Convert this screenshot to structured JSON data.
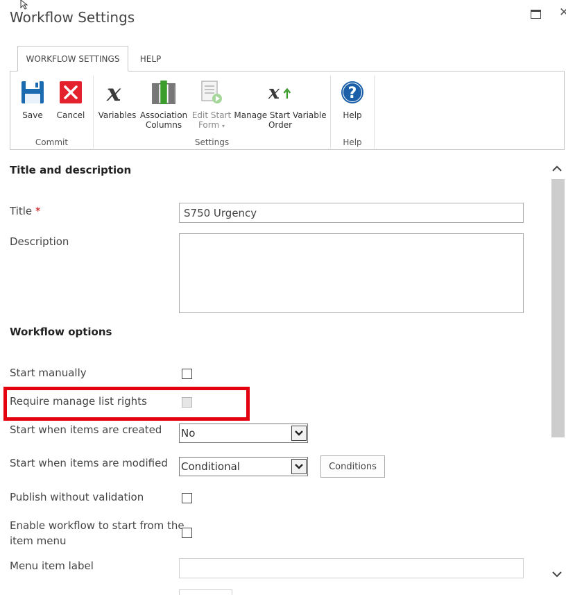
{
  "dialog": {
    "title": "Workflow Settings"
  },
  "tabs": [
    {
      "label": "WORKFLOW SETTINGS"
    },
    {
      "label": "HELP"
    }
  ],
  "ribbon": {
    "groups": [
      {
        "label": "Commit"
      },
      {
        "label": "Settings"
      },
      {
        "label": "Help"
      }
    ],
    "buttons": {
      "save": {
        "line1": "Save",
        "icon": "save-icon"
      },
      "cancel": {
        "line1": "Cancel",
        "icon": "cancel-icon"
      },
      "variables": {
        "line1": "Variables",
        "icon": "variable-icon"
      },
      "association_columns": {
        "line1": "Association",
        "line2": "Columns",
        "icon": "columns-icon"
      },
      "edit_start_form": {
        "line1": "Edit Start",
        "line2": "Form",
        "caret": "▾",
        "icon": "edit-form-icon",
        "disabled": true
      },
      "manage_start_variable_order": {
        "line1": "Manage Start Variable",
        "line2": "Order",
        "icon": "variable-order-icon"
      },
      "help": {
        "line1": "Help",
        "icon": "help-icon"
      }
    }
  },
  "sections": {
    "title_description": {
      "heading": "Title and description"
    },
    "workflow_options": {
      "heading": "Workflow options"
    }
  },
  "fields": {
    "title": {
      "label": "Title",
      "required_marker": "*",
      "value": "S750 Urgency"
    },
    "description": {
      "label": "Description",
      "value": ""
    },
    "start_manually": {
      "label": "Start manually",
      "checked": false
    },
    "require_manage_list_rights": {
      "label": "Require manage list rights",
      "checked": false,
      "disabled": true
    },
    "start_when_created": {
      "label": "Start when items are created",
      "selected": "No"
    },
    "start_when_modified": {
      "label": "Start when items are modified",
      "selected": "Conditional",
      "button": "Conditions"
    },
    "publish_without_validation": {
      "label": "Publish without validation",
      "checked": false
    },
    "enable_item_menu": {
      "label_line1": "Enable workflow to start from the",
      "label_line2": "item menu",
      "checked": false
    },
    "menu_item_label": {
      "label": "Menu item label",
      "value": ""
    }
  },
  "colors": {
    "save_blue": "#1c6ab0",
    "cancel_red": "#e3222d",
    "help_blue": "#1a5fa8",
    "association_green": "#3c9c2c",
    "highlight_red": "#e3000f",
    "scroll_thumb": "#cdcdcd"
  }
}
